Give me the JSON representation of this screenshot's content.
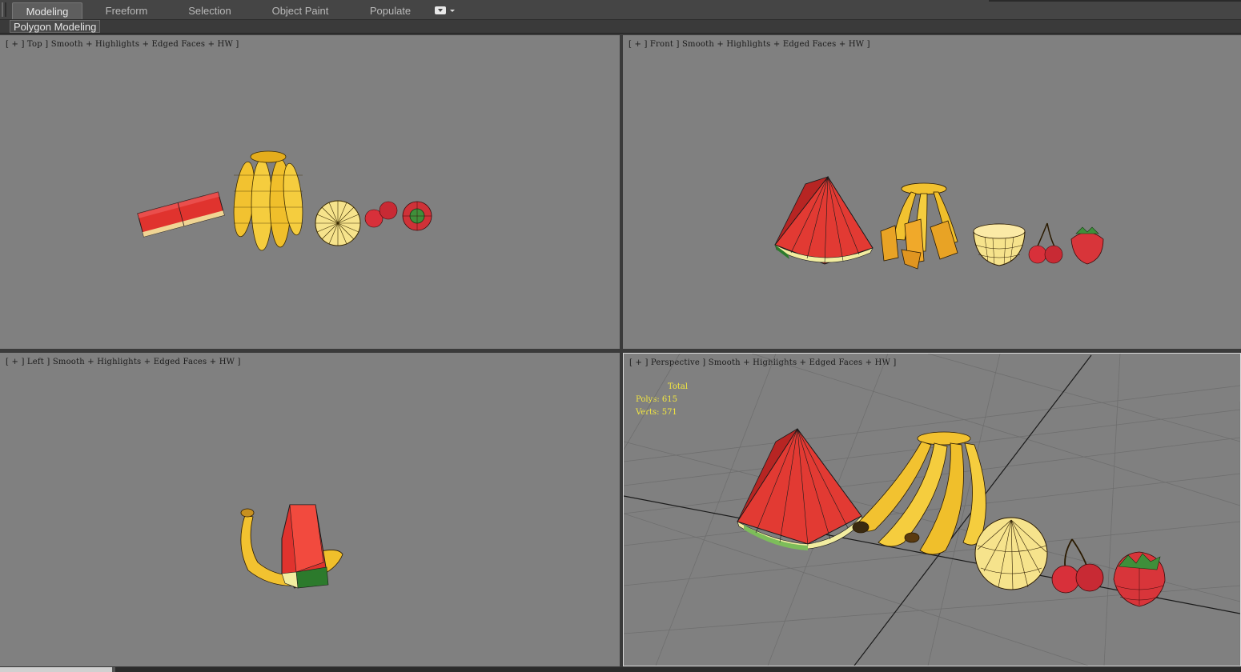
{
  "ribbon": {
    "tabs": [
      {
        "label": "Modeling",
        "active": true
      },
      {
        "label": "Freeform"
      },
      {
        "label": "Selection"
      },
      {
        "label": "Object Paint"
      },
      {
        "label": "Populate"
      }
    ],
    "panel_label": "Polygon Modeling"
  },
  "viewports": {
    "top": {
      "label": "[ + ] Top ] Smooth + Highlights + Edged Faces + HW ]"
    },
    "front": {
      "label": "[ + ] Front ] Smooth + Highlights + Edged Faces + HW ]"
    },
    "left": {
      "label": "[ + ] Left ] Smooth + Highlights + Edged Faces + HW ]"
    },
    "perspective": {
      "label": "[ + ] Perspective ] Smooth + Highlights + Edged Faces + HW ]",
      "stats": {
        "title": "Total",
        "polys": "Polys: 615",
        "verts": "Verts: 571"
      }
    }
  },
  "colors": {
    "viewport_bg": "#808080",
    "watermelon": "#e0332e",
    "banana": "#f2c230",
    "melon": "#f6e38c",
    "cherry": "#d8303a",
    "leaf": "#2f7f2f",
    "stats_text": "#f2e640"
  }
}
